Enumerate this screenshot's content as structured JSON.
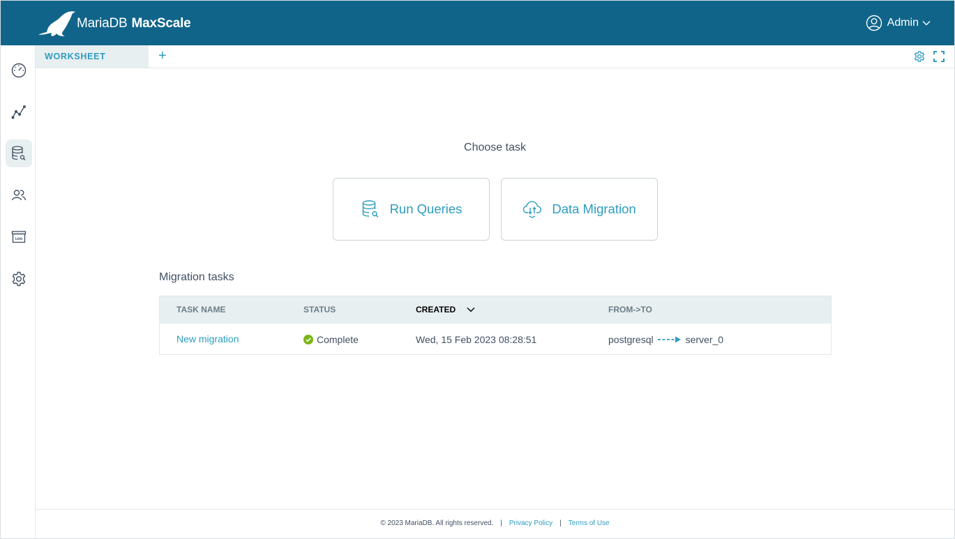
{
  "header": {
    "brand_name": "MariaDB",
    "product_name": "MaxScale",
    "user_label": "Admin",
    "bg_color": "#10648a"
  },
  "sidebar": {
    "items": [
      {
        "icon": "dashboard-icon"
      },
      {
        "icon": "visualization-icon"
      },
      {
        "icon": "query-editor-icon",
        "active": true
      },
      {
        "icon": "users-icon"
      },
      {
        "icon": "logs-archive-icon"
      },
      {
        "icon": "settings-icon"
      }
    ]
  },
  "tabs": {
    "items": [
      {
        "label": "WORKSHEET"
      }
    ],
    "add_label": "+"
  },
  "main": {
    "choose_title": "Choose task",
    "cards": [
      {
        "label": "Run Queries",
        "icon": "database-search-icon"
      },
      {
        "label": "Data Migration",
        "icon": "cloud-transfer-icon"
      }
    ],
    "migration_title": "Migration tasks",
    "table": {
      "headers": [
        "TASK NAME",
        "STATUS",
        "CREATED",
        "FROM->TO"
      ],
      "rows": [
        {
          "task_name": "New migration",
          "status": "Complete",
          "created": "Wed, 15 Feb 2023 08:28:51",
          "from": "postgresql",
          "to": "server_0"
        }
      ]
    }
  },
  "footer": {
    "copyright": "© 2023 MariaDB. All rights reserved.",
    "separator": "|",
    "privacy": "Privacy Policy",
    "terms": "Terms of Use"
  },
  "colors": {
    "accent": "#2d9cbf",
    "status_success": "#7cb518",
    "text": "#424f62"
  }
}
